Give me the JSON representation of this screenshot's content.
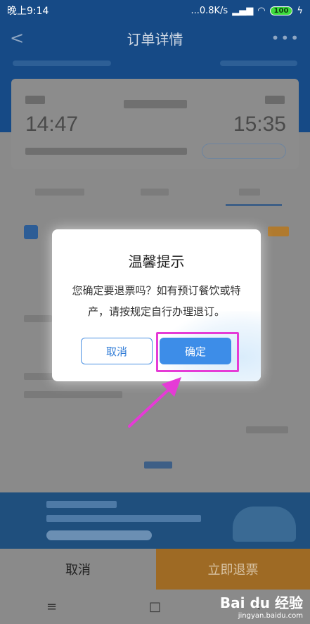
{
  "status_bar": {
    "time": "晚上9:14",
    "network": "...0.8K/s",
    "battery": "100"
  },
  "app_bar": {
    "title": "订单详情",
    "back_icon": "chevron-left-icon",
    "more_icon": "more-dots-icon"
  },
  "ticket": {
    "depart_time": "14:47",
    "arrive_time": "15:35"
  },
  "dialog": {
    "title": "温馨提示",
    "message": "您确定要退票吗？如有预订餐饮或特产，请按规定自行办理退订。",
    "cancel_label": "取消",
    "confirm_label": "确定"
  },
  "bottom_bar": {
    "cancel_label": "取消",
    "refund_label": "立即退票"
  },
  "nav_bar": {
    "menu_icon": "≡",
    "home_icon": "□",
    "back_icon": "‹"
  },
  "watermark": {
    "line1": "Bai du 经验",
    "line2": "jingyan.baidu.com"
  },
  "colors": {
    "highlight": "#e53bd6",
    "confirm_button": "#3d8de8",
    "refund_bar": "#e89a2f"
  }
}
